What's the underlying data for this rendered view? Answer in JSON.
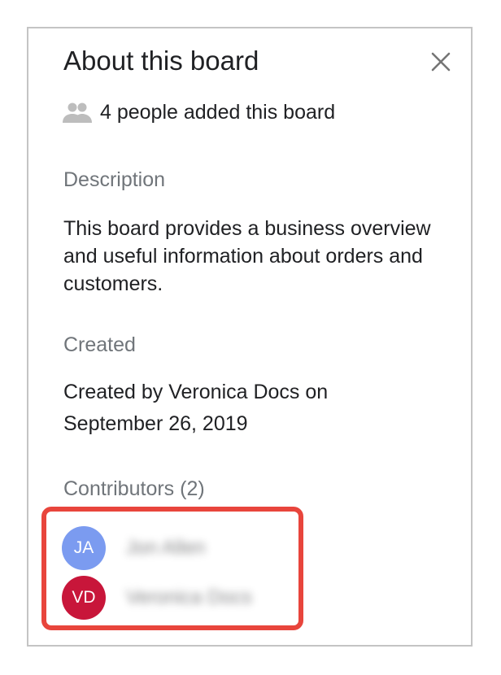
{
  "panel": {
    "title": "About this board",
    "close_icon": "close-icon"
  },
  "people": {
    "icon": "people-icon",
    "text": "4 people added this board"
  },
  "description": {
    "label": "Description",
    "text": "This board provides a business overview and useful information about orders and customers."
  },
  "created": {
    "label": "Created",
    "text": "Created by Veronica Docs on September 26, 2019"
  },
  "contributors": {
    "label": "Contributors (2)",
    "items": [
      {
        "initials": "JA",
        "name": "Jon Allen",
        "avatar_color": "#7b9bf0"
      },
      {
        "initials": "VD",
        "name": "Veronica Docs",
        "avatar_color": "#c8163a"
      }
    ]
  },
  "colors": {
    "highlight_border": "#e8453c",
    "label_gray": "#70757a",
    "text_dark": "#202124"
  }
}
